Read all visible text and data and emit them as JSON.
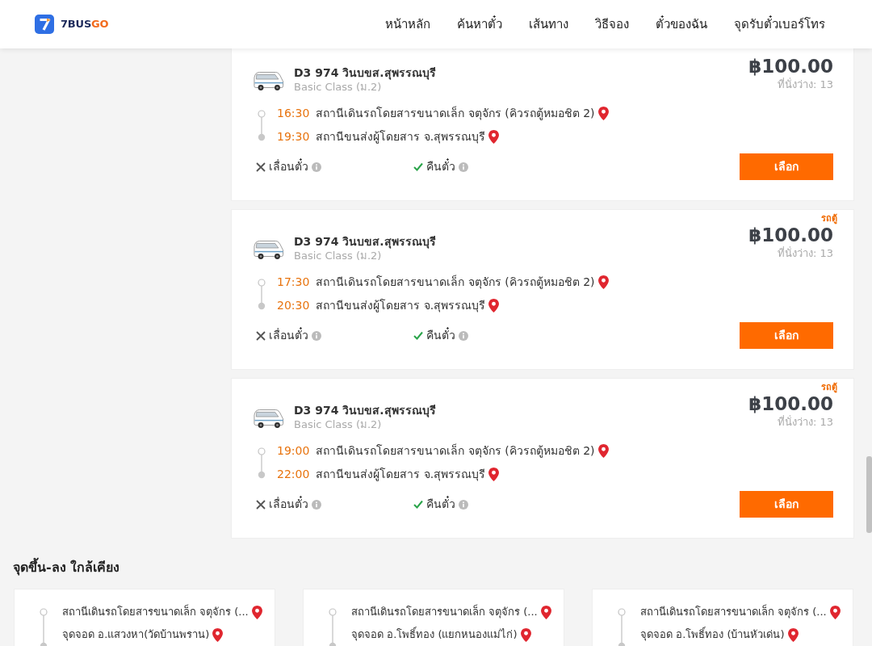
{
  "header": {
    "logo": {
      "text_main": "7BUS",
      "text_accent": "GO"
    },
    "nav": [
      {
        "label": "หน้าหลัก"
      },
      {
        "label": "ค้นหาตั๋ว"
      },
      {
        "label": "เส้นทาง"
      },
      {
        "label": "วิธีจอง"
      },
      {
        "label": "ตั๋วของฉัน"
      },
      {
        "label": "จุดรับตั๋วเบอร์โทร"
      }
    ]
  },
  "trips": [
    {
      "title": "D3 974 วินบขส.สุพรรณบุรี",
      "class": "Basic Class (ม.2)",
      "price": "฿100.00",
      "seats": "ที่นั่งว่าง: 13",
      "departure": {
        "time": "16:30",
        "station": "สถานีเดินรถโดยสารขนาดเล็ก จตุจักร (คิวรถตู้หมอชิต 2)"
      },
      "arrival": {
        "time": "19:30",
        "station": "สถานีขนส่งผู้โดยสาร จ.สุพรรณบุรี"
      },
      "policies": [
        {
          "label": "เลื่อนตั๋ว",
          "allowed": false
        },
        {
          "label": "คืนตั๋ว",
          "allowed": true
        }
      ],
      "button": "เลือก"
    },
    {
      "vehicle_type": "รถตู้",
      "title": "D3 974 วินบขส.สุพรรณบุรี",
      "class": "Basic Class (ม.2)",
      "price": "฿100.00",
      "seats": "ที่นั่งว่าง: 13",
      "departure": {
        "time": "17:30",
        "station": "สถานีเดินรถโดยสารขนาดเล็ก จตุจักร (คิวรถตู้หมอชิต 2)"
      },
      "arrival": {
        "time": "20:30",
        "station": "สถานีขนส่งผู้โดยสาร จ.สุพรรณบุรี"
      },
      "policies": [
        {
          "label": "เลื่อนตั๋ว",
          "allowed": false
        },
        {
          "label": "คืนตั๋ว",
          "allowed": true
        }
      ],
      "button": "เลือก"
    },
    {
      "vehicle_type": "รถตู้",
      "title": "D3 974 วินบขส.สุพรรณบุรี",
      "class": "Basic Class (ม.2)",
      "price": "฿100.00",
      "seats": "ที่นั่งว่าง: 13",
      "departure": {
        "time": "19:00",
        "station": "สถานีเดินรถโดยสารขนาดเล็ก จตุจักร (คิวรถตู้หมอชิต 2)"
      },
      "arrival": {
        "time": "22:00",
        "station": "สถานีขนส่งผู้โดยสาร จ.สุพรรณบุรี"
      },
      "policies": [
        {
          "label": "เลื่อนตั๋ว",
          "allowed": false
        },
        {
          "label": "คืนตั๋ว",
          "allowed": true
        }
      ],
      "button": "เลือก"
    }
  ],
  "nearby": {
    "title": "จุดขึ้น-ลง ใกล้เคียง",
    "routes": [
      {
        "origin": "สถานีเดินรถโดยสารขนาดเล็ก จตุจักร (...",
        "destination": "จุดจอด อ.แสวงหา(วัดบ้านพราน)"
      },
      {
        "origin": "สถานีเดินรถโดยสารขนาดเล็ก จตุจักร (...",
        "destination": "จุดจอด อ.โพธิ์ทอง (แยกหนองแม่ไก่)"
      },
      {
        "origin": "สถานีเดินรถโดยสารขนาดเล็ก จตุจักร (...",
        "destination": "จุดจอด อ.โพธิ์ทอง (บ้านหัวเด่น)"
      }
    ]
  }
}
